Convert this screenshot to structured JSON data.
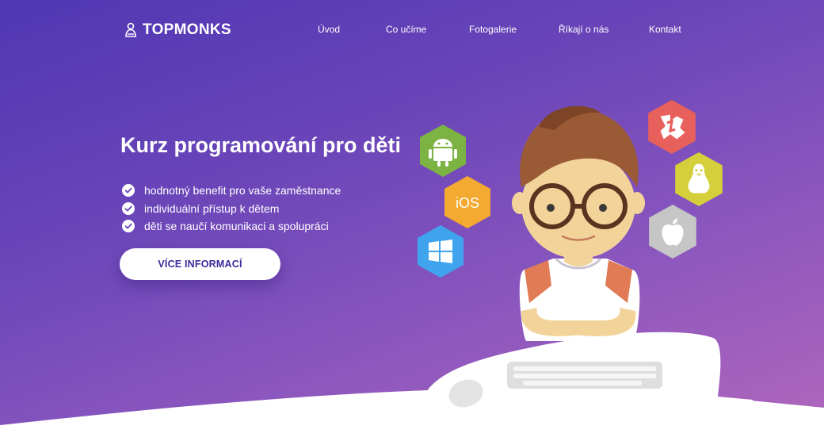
{
  "brand": {
    "name": "TOPMONKS",
    "logo_icon": "monk-icon"
  },
  "nav": {
    "items": [
      {
        "label": "Úvod"
      },
      {
        "label": "Co učíme"
      },
      {
        "label": "Fotogalerie"
      },
      {
        "label": "Říkají o nás"
      },
      {
        "label": "Kontakt"
      }
    ]
  },
  "hero": {
    "title": "Kurz programování pro děti",
    "benefits": [
      "hodnotný benefit pro vaše zaměstnance",
      "individuální přístup k dětem",
      "děti se naučí komunikaci a spolupráci"
    ],
    "cta_label": "VÍCE INFORMACÍ"
  },
  "platforms": [
    {
      "name": "android-icon",
      "color": "#7cb342"
    },
    {
      "name": "ios-icon",
      "label": "iOS",
      "color": "#f4a930"
    },
    {
      "name": "windows-icon",
      "color": "#3fa3ee"
    },
    {
      "name": "scratch-icon",
      "color": "#e8605c"
    },
    {
      "name": "linux-icon",
      "color": "#d4cf3a"
    },
    {
      "name": "apple-icon",
      "color": "#c6c6c6"
    }
  ],
  "colors": {
    "accent": "#3a2a9a",
    "gradient_start": "#4f37b4",
    "gradient_end": "#b267bb"
  }
}
